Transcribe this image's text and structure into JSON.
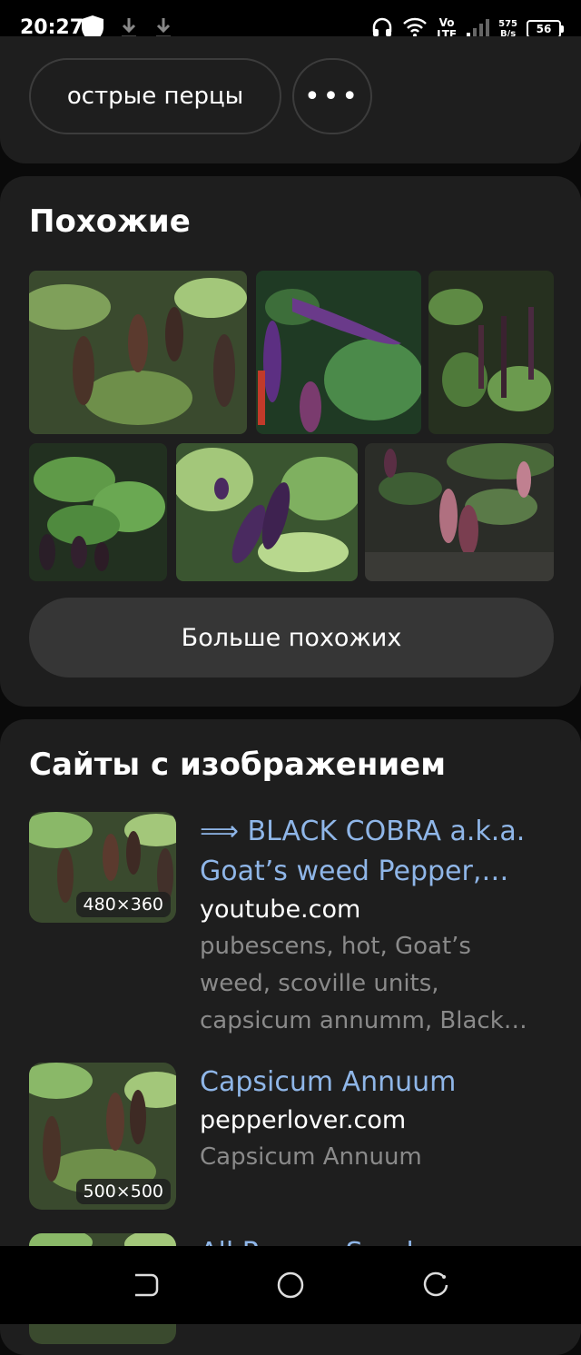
{
  "status_bar": {
    "time": "20:27",
    "network_top": "Vo",
    "network_bottom": "LTE",
    "speed_value": "575",
    "speed_unit": "B/s",
    "battery": "56"
  },
  "tags": {
    "chip_label": "острые перцы",
    "more_label": "•••"
  },
  "similar": {
    "title": "Похожие",
    "more_button": "Больше похожих"
  },
  "sites": {
    "title": "Сайты с изображением",
    "items": [
      {
        "title": "⟹ BLACK COBRA a.k.a. Goat’s weed Pepper,…",
        "domain": "youtube.com",
        "description": "pubescens, hot, Goat’s weed, scoville units, capsicum annumm, Black…",
        "size": "480×360"
      },
      {
        "title": "Capsicum Annuum",
        "domain": "pepperlover.com",
        "description": "Capsicum Annuum",
        "size": "500×500"
      },
      {
        "title": "All Pepper Seeds",
        "domain": "",
        "description": "",
        "size": ""
      }
    ]
  },
  "colors": {
    "background": "#0a0a0a",
    "card": "#1e1e1e",
    "link": "#8fb6e8",
    "muted": "#8a8a8a"
  }
}
